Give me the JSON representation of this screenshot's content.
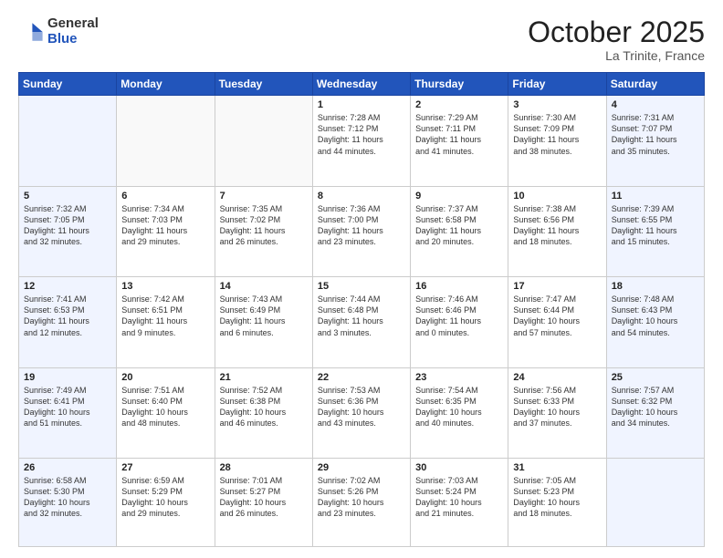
{
  "logo": {
    "general": "General",
    "blue": "Blue"
  },
  "header": {
    "month": "October 2025",
    "location": "La Trinite, France"
  },
  "weekdays": [
    "Sunday",
    "Monday",
    "Tuesday",
    "Wednesday",
    "Thursday",
    "Friday",
    "Saturday"
  ],
  "weeks": [
    [
      {
        "day": "",
        "text": ""
      },
      {
        "day": "",
        "text": ""
      },
      {
        "day": "",
        "text": ""
      },
      {
        "day": "1",
        "text": "Sunrise: 7:28 AM\nSunset: 7:12 PM\nDaylight: 11 hours\nand 44 minutes."
      },
      {
        "day": "2",
        "text": "Sunrise: 7:29 AM\nSunset: 7:11 PM\nDaylight: 11 hours\nand 41 minutes."
      },
      {
        "day": "3",
        "text": "Sunrise: 7:30 AM\nSunset: 7:09 PM\nDaylight: 11 hours\nand 38 minutes."
      },
      {
        "day": "4",
        "text": "Sunrise: 7:31 AM\nSunset: 7:07 PM\nDaylight: 11 hours\nand 35 minutes."
      }
    ],
    [
      {
        "day": "5",
        "text": "Sunrise: 7:32 AM\nSunset: 7:05 PM\nDaylight: 11 hours\nand 32 minutes."
      },
      {
        "day": "6",
        "text": "Sunrise: 7:34 AM\nSunset: 7:03 PM\nDaylight: 11 hours\nand 29 minutes."
      },
      {
        "day": "7",
        "text": "Sunrise: 7:35 AM\nSunset: 7:02 PM\nDaylight: 11 hours\nand 26 minutes."
      },
      {
        "day": "8",
        "text": "Sunrise: 7:36 AM\nSunset: 7:00 PM\nDaylight: 11 hours\nand 23 minutes."
      },
      {
        "day": "9",
        "text": "Sunrise: 7:37 AM\nSunset: 6:58 PM\nDaylight: 11 hours\nand 20 minutes."
      },
      {
        "day": "10",
        "text": "Sunrise: 7:38 AM\nSunset: 6:56 PM\nDaylight: 11 hours\nand 18 minutes."
      },
      {
        "day": "11",
        "text": "Sunrise: 7:39 AM\nSunset: 6:55 PM\nDaylight: 11 hours\nand 15 minutes."
      }
    ],
    [
      {
        "day": "12",
        "text": "Sunrise: 7:41 AM\nSunset: 6:53 PM\nDaylight: 11 hours\nand 12 minutes."
      },
      {
        "day": "13",
        "text": "Sunrise: 7:42 AM\nSunset: 6:51 PM\nDaylight: 11 hours\nand 9 minutes."
      },
      {
        "day": "14",
        "text": "Sunrise: 7:43 AM\nSunset: 6:49 PM\nDaylight: 11 hours\nand 6 minutes."
      },
      {
        "day": "15",
        "text": "Sunrise: 7:44 AM\nSunset: 6:48 PM\nDaylight: 11 hours\nand 3 minutes."
      },
      {
        "day": "16",
        "text": "Sunrise: 7:46 AM\nSunset: 6:46 PM\nDaylight: 11 hours\nand 0 minutes."
      },
      {
        "day": "17",
        "text": "Sunrise: 7:47 AM\nSunset: 6:44 PM\nDaylight: 10 hours\nand 57 minutes."
      },
      {
        "day": "18",
        "text": "Sunrise: 7:48 AM\nSunset: 6:43 PM\nDaylight: 10 hours\nand 54 minutes."
      }
    ],
    [
      {
        "day": "19",
        "text": "Sunrise: 7:49 AM\nSunset: 6:41 PM\nDaylight: 10 hours\nand 51 minutes."
      },
      {
        "day": "20",
        "text": "Sunrise: 7:51 AM\nSunset: 6:40 PM\nDaylight: 10 hours\nand 48 minutes."
      },
      {
        "day": "21",
        "text": "Sunrise: 7:52 AM\nSunset: 6:38 PM\nDaylight: 10 hours\nand 46 minutes."
      },
      {
        "day": "22",
        "text": "Sunrise: 7:53 AM\nSunset: 6:36 PM\nDaylight: 10 hours\nand 43 minutes."
      },
      {
        "day": "23",
        "text": "Sunrise: 7:54 AM\nSunset: 6:35 PM\nDaylight: 10 hours\nand 40 minutes."
      },
      {
        "day": "24",
        "text": "Sunrise: 7:56 AM\nSunset: 6:33 PM\nDaylight: 10 hours\nand 37 minutes."
      },
      {
        "day": "25",
        "text": "Sunrise: 7:57 AM\nSunset: 6:32 PM\nDaylight: 10 hours\nand 34 minutes."
      }
    ],
    [
      {
        "day": "26",
        "text": "Sunrise: 6:58 AM\nSunset: 5:30 PM\nDaylight: 10 hours\nand 32 minutes."
      },
      {
        "day": "27",
        "text": "Sunrise: 6:59 AM\nSunset: 5:29 PM\nDaylight: 10 hours\nand 29 minutes."
      },
      {
        "day": "28",
        "text": "Sunrise: 7:01 AM\nSunset: 5:27 PM\nDaylight: 10 hours\nand 26 minutes."
      },
      {
        "day": "29",
        "text": "Sunrise: 7:02 AM\nSunset: 5:26 PM\nDaylight: 10 hours\nand 23 minutes."
      },
      {
        "day": "30",
        "text": "Sunrise: 7:03 AM\nSunset: 5:24 PM\nDaylight: 10 hours\nand 21 minutes."
      },
      {
        "day": "31",
        "text": "Sunrise: 7:05 AM\nSunset: 5:23 PM\nDaylight: 10 hours\nand 18 minutes."
      },
      {
        "day": "",
        "text": ""
      }
    ]
  ]
}
